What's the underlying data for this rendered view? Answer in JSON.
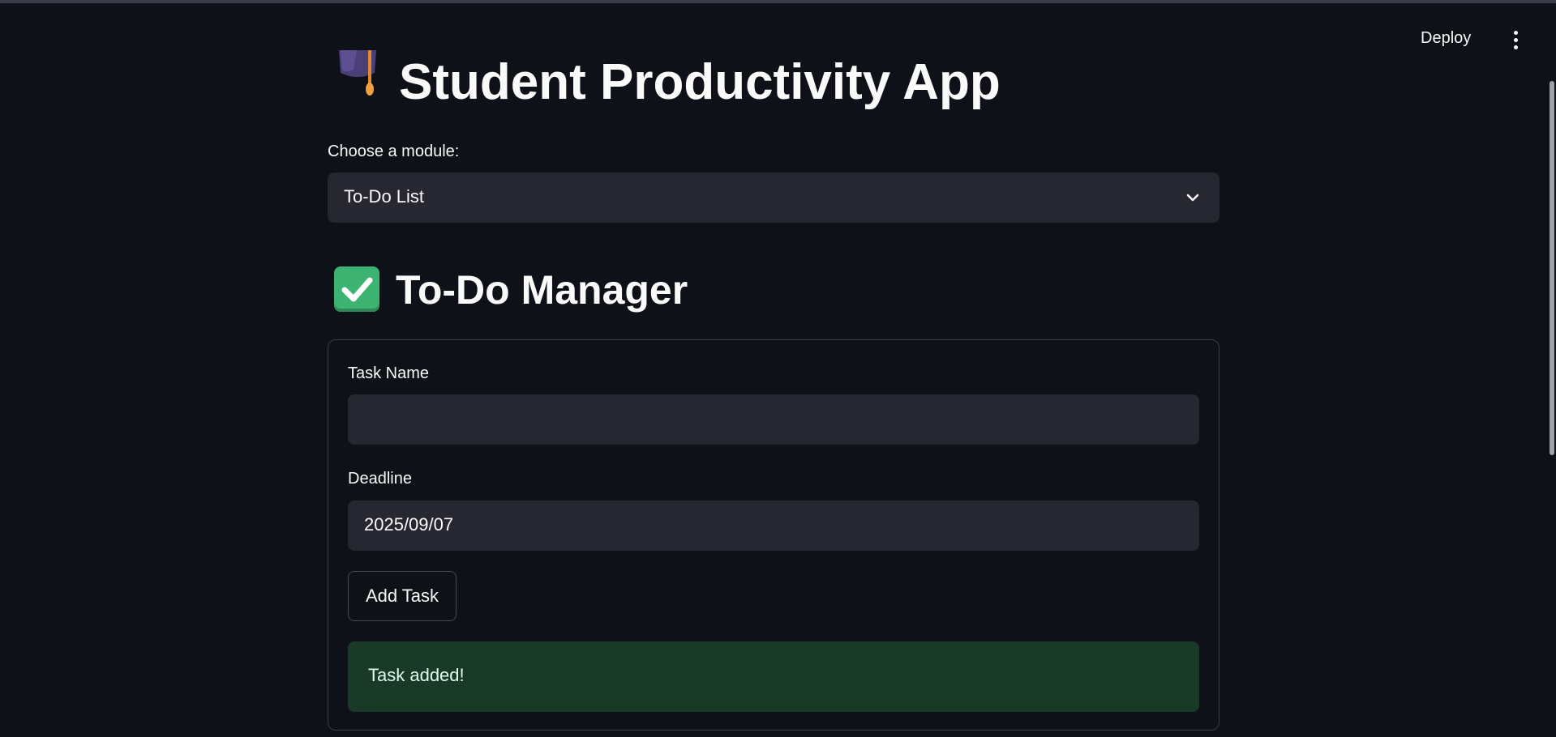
{
  "header": {
    "deploy_label": "Deploy",
    "menu_icon": "kebab-menu-icon"
  },
  "app": {
    "title": "Student Productivity App",
    "title_icon": "graduation-cap-icon"
  },
  "module_select": {
    "label": "Choose a module:",
    "value": "To-Do List"
  },
  "todo": {
    "title": "To-Do Manager",
    "title_icon": "check-mark-button-icon",
    "task_name_label": "Task Name",
    "task_name_value": "",
    "deadline_label": "Deadline",
    "deadline_value": "2025/09/07",
    "add_button_label": "Add Task",
    "success_message": "Task added!"
  },
  "colors": {
    "background": "#0e1117",
    "input_bg": "#262730",
    "success_bg": "#193a27",
    "success_text": "#dffde9",
    "check_green": "#3cb371"
  }
}
